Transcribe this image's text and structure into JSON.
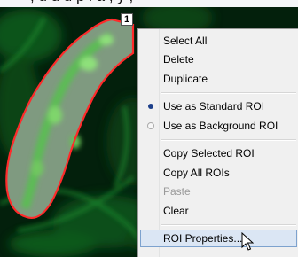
{
  "roi": {
    "badge_number": "1",
    "outline_color": "#ff2a2a"
  },
  "menu": {
    "items": [
      {
        "label": "Select All"
      },
      {
        "label": "Delete"
      },
      {
        "label": "Duplicate"
      },
      {
        "label": "Use as Standard ROI",
        "radio": "selected"
      },
      {
        "label": "Use as Background ROI",
        "radio": "unselected"
      },
      {
        "label": "Copy Selected ROI"
      },
      {
        "label": "Copy All ROIs"
      },
      {
        "label": "Paste",
        "disabled": true
      },
      {
        "label": "Clear"
      },
      {
        "label": "ROI Properties...",
        "highlighted": true
      }
    ]
  },
  "colors": {
    "menu_background": "#f0f0f0",
    "highlight_background": "#dbe6f4",
    "highlight_border": "#7da2ce",
    "fluorescence": "#3cc83c"
  }
}
